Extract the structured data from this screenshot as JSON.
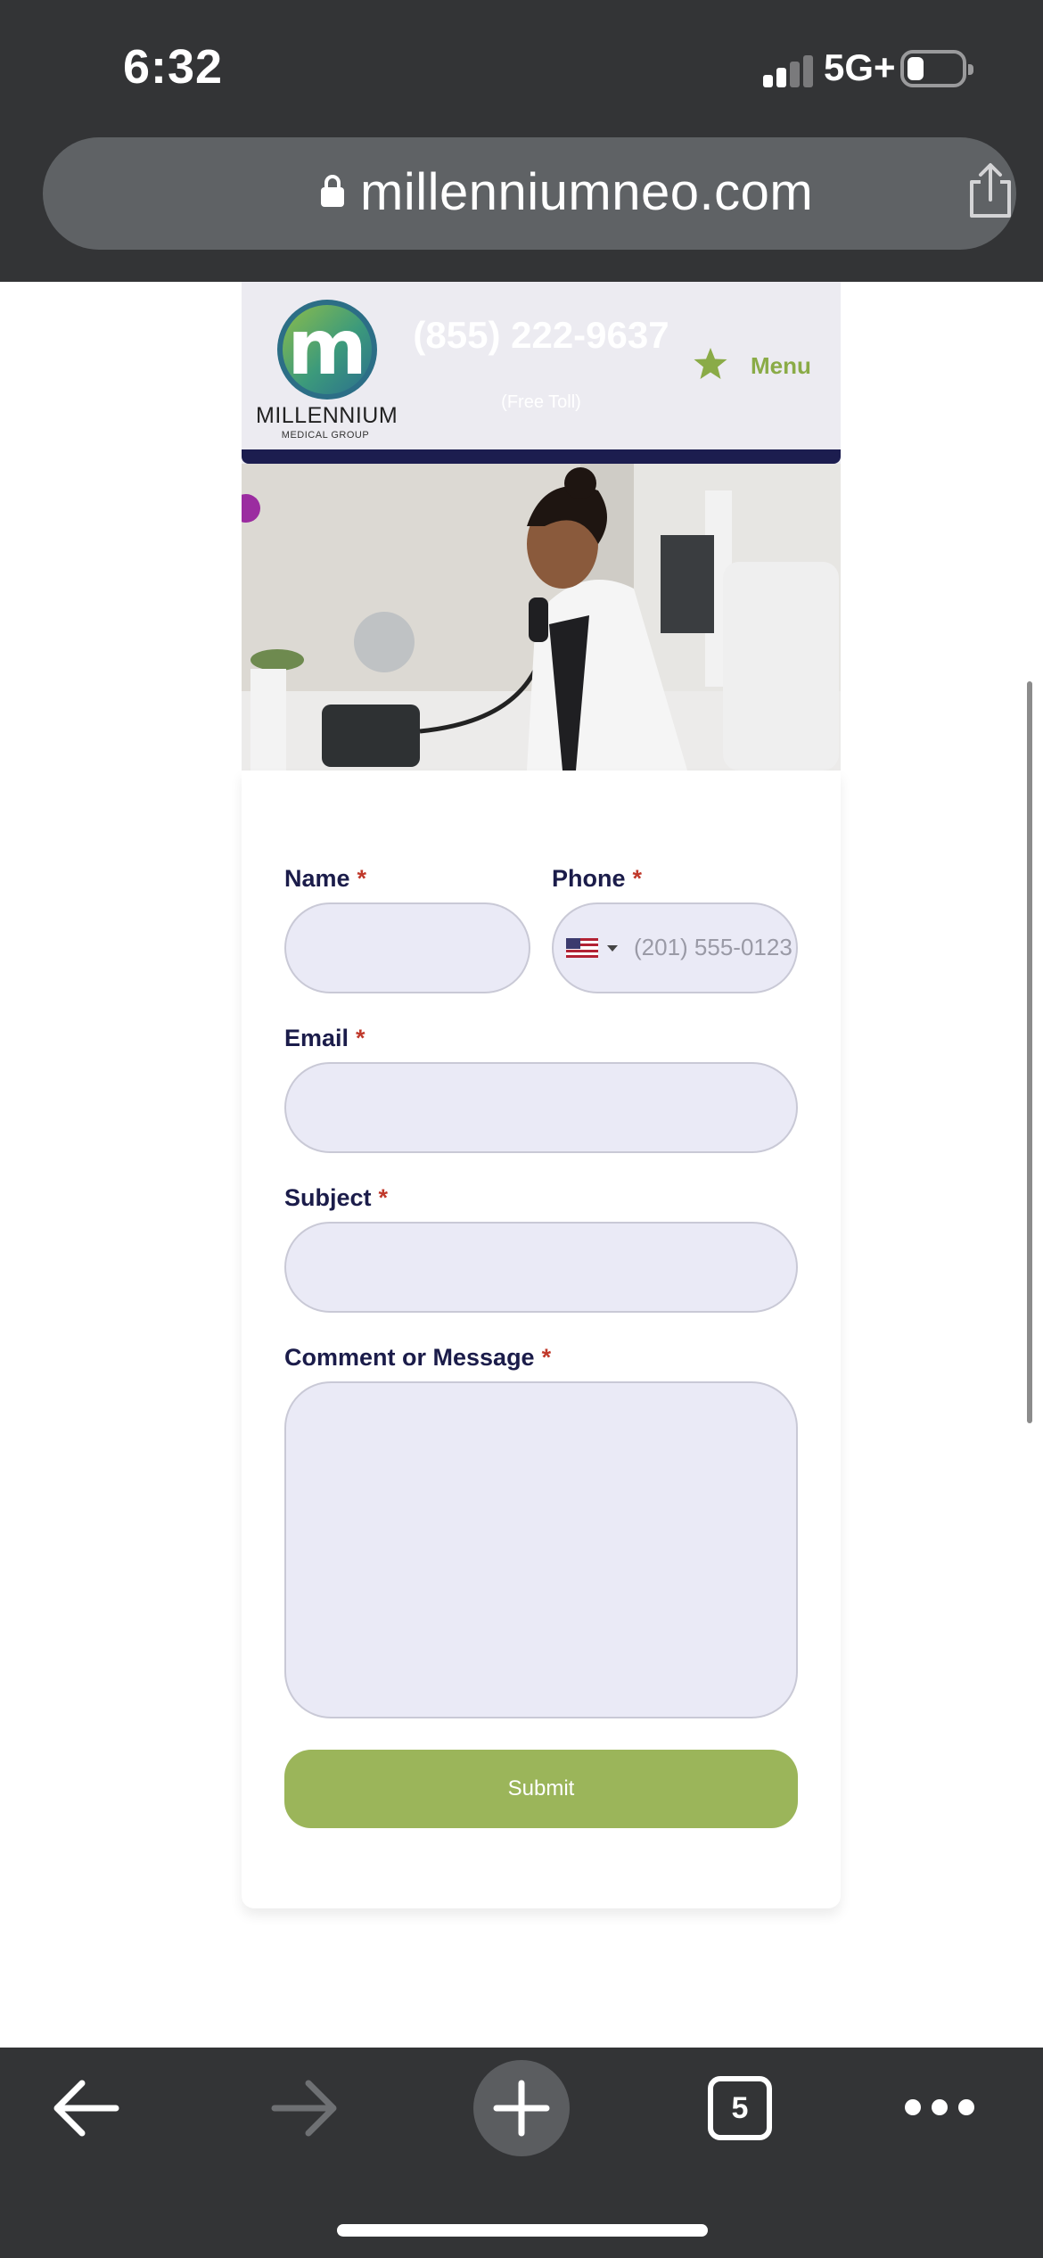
{
  "status_bar": {
    "time": "6:32",
    "network": "5G+"
  },
  "browser": {
    "url": "millenniumneo.com",
    "tab_count": "5"
  },
  "site_header": {
    "logo_letter": "m",
    "logo_name": "MILLENNIUM",
    "logo_sub": "MEDICAL GROUP",
    "phone": "(855) 222-9637",
    "phone_note": "(Free Toll)",
    "menu_label": "Menu"
  },
  "form": {
    "name_label": "Name",
    "phone_label": "Phone",
    "phone_placeholder": "(201) 555-0123",
    "email_label": "Email",
    "subject_label": "Subject",
    "message_label": "Comment or Message",
    "required_mark": "*",
    "submit_label": "Submit"
  },
  "colors": {
    "chrome_bg": "#333436",
    "accent_green": "#9bb55a",
    "label_navy": "#1b1c4a",
    "required_red": "#c0392b",
    "input_bg": "#eaeaf6"
  }
}
